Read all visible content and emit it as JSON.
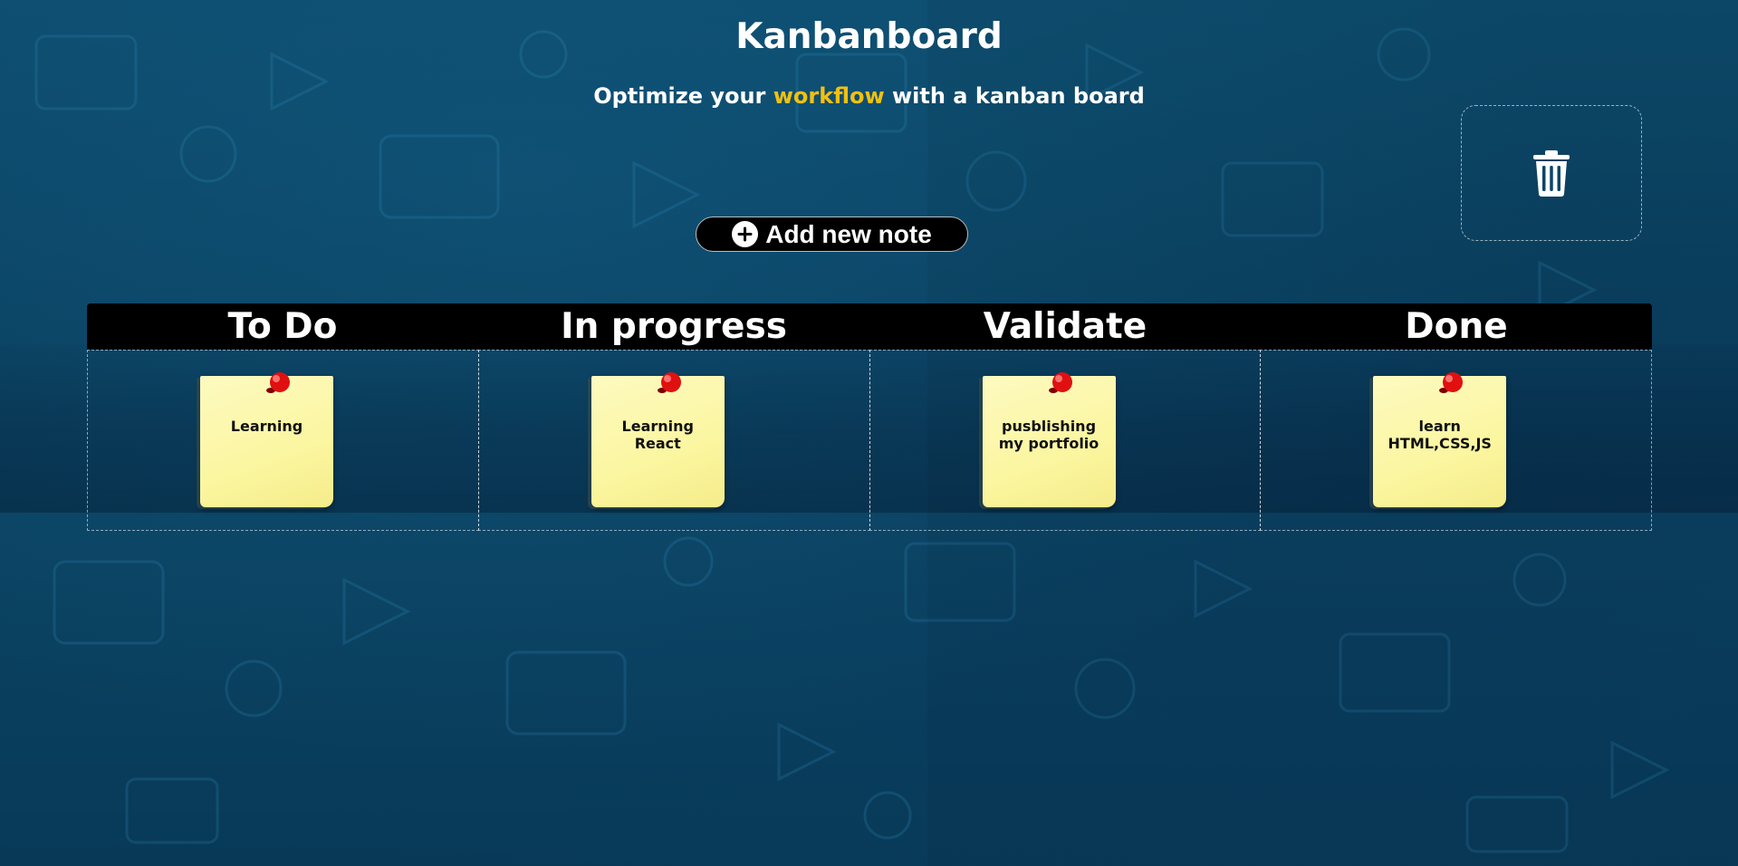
{
  "header": {
    "title": "Kanbanboard",
    "subtitle_before": "Optimize your ",
    "subtitle_highlight": "workflow",
    "subtitle_after": " with a kanban board",
    "highlight_color": "#f2c011"
  },
  "trash": {
    "icon": "trash-icon"
  },
  "add_button": {
    "label": "Add new note",
    "icon": "plus-circle-icon"
  },
  "board": {
    "columns": [
      {
        "title": "To Do",
        "notes": [
          "Learning"
        ]
      },
      {
        "title": "In progress",
        "notes": [
          "Learning React"
        ]
      },
      {
        "title": "Validate",
        "notes": [
          "pusblishing my portfolio"
        ]
      },
      {
        "title": "Done",
        "notes": [
          "learn HTML,CSS,JS"
        ]
      }
    ]
  },
  "colors": {
    "background": "#0c4566",
    "note": "#fbf6a0",
    "pin": "#e01010",
    "header_bar": "#000000"
  }
}
